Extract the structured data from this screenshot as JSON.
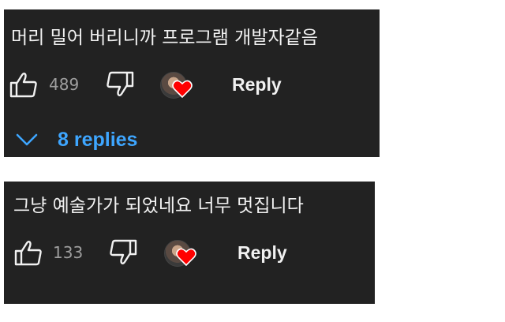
{
  "comments": [
    {
      "text": "머리 밀어 버리니까 프로그램 개발자같음",
      "like_count": "489",
      "reply_label": "Reply",
      "replies_label": "8 replies"
    },
    {
      "text": "그냥 예술가가 되었네요 너무 멋집니다",
      "like_count": "133",
      "reply_label": "Reply"
    }
  ],
  "icons": {
    "like": "thumbs-up-outline",
    "dislike": "thumbs-down-outline",
    "creator_heart": "creator-avatar-with-red-heart",
    "expand": "chevron-down"
  },
  "colors": {
    "card_bg": "#222222",
    "text": "#f1f1f1",
    "muted": "#9e9e9e",
    "link_blue": "#3ea6ff",
    "heart_red": "#ff0000"
  }
}
